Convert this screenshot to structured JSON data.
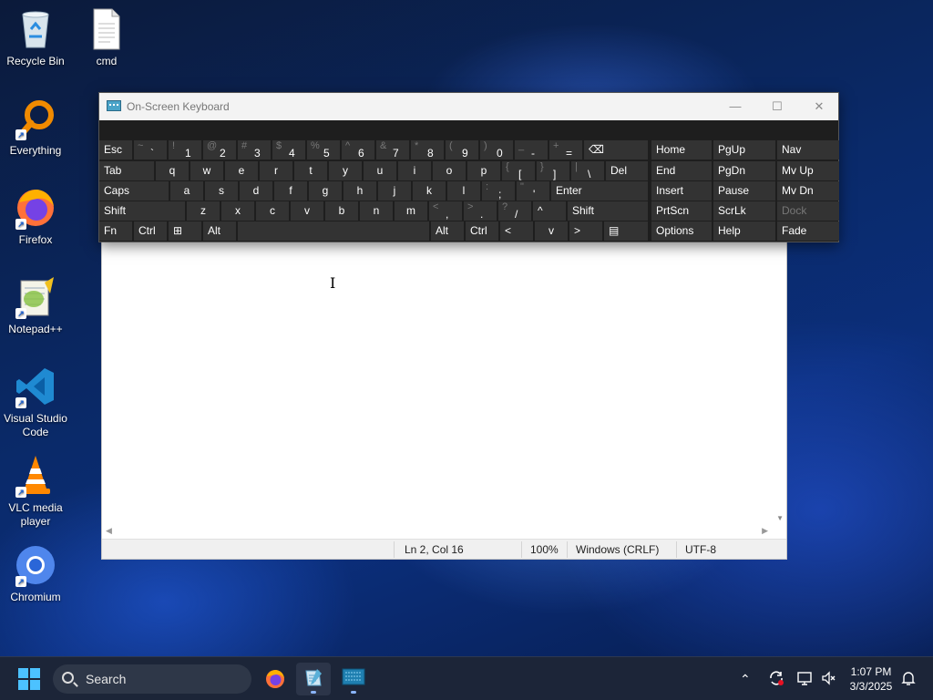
{
  "desktop": {
    "icons": [
      {
        "label": "Recycle Bin",
        "icon": "recycle-bin-icon"
      },
      {
        "label": "cmd",
        "icon": "file-icon"
      },
      {
        "label": "Everything",
        "icon": "everything-search-icon"
      },
      {
        "label": "Firefox",
        "icon": "firefox-icon"
      },
      {
        "label": "Notepad++",
        "icon": "notepad-plus-plus-icon"
      },
      {
        "label": "Visual Studio Code",
        "icon": "vscode-icon"
      },
      {
        "label": "VLC media player",
        "icon": "vlc-icon"
      },
      {
        "label": "Chromium",
        "icon": "chromium-icon"
      }
    ]
  },
  "osk": {
    "title": "On-Screen Keyboard",
    "row1": [
      {
        "label": "Esc"
      },
      {
        "shift": "~",
        "main": "`"
      },
      {
        "shift": "!",
        "main": "1"
      },
      {
        "shift": "@",
        "main": "2"
      },
      {
        "shift": "#",
        "main": "3"
      },
      {
        "shift": "$",
        "main": "4"
      },
      {
        "shift": "%",
        "main": "5"
      },
      {
        "shift": "^",
        "main": "6"
      },
      {
        "shift": "&",
        "main": "7"
      },
      {
        "shift": "*",
        "main": "8"
      },
      {
        "shift": "(",
        "main": "9"
      },
      {
        "shift": ")",
        "main": "0"
      },
      {
        "shift": "_",
        "main": "-"
      },
      {
        "shift": "+",
        "main": "="
      },
      {
        "label": "⌫"
      }
    ],
    "row2": [
      {
        "label": "Tab"
      },
      {
        "label": "q"
      },
      {
        "label": "w"
      },
      {
        "label": "e"
      },
      {
        "label": "r"
      },
      {
        "label": "t"
      },
      {
        "label": "y"
      },
      {
        "label": "u"
      },
      {
        "label": "i"
      },
      {
        "label": "o"
      },
      {
        "label": "p"
      },
      {
        "shift": "{",
        "main": "["
      },
      {
        "shift": "}",
        "main": "]"
      },
      {
        "shift": "|",
        "main": "\\"
      },
      {
        "label": "Del"
      }
    ],
    "row3": [
      {
        "label": "Caps"
      },
      {
        "label": "a"
      },
      {
        "label": "s"
      },
      {
        "label": "d"
      },
      {
        "label": "f"
      },
      {
        "label": "g"
      },
      {
        "label": "h"
      },
      {
        "label": "j"
      },
      {
        "label": "k"
      },
      {
        "label": "l"
      },
      {
        "shift": ":",
        "main": ";"
      },
      {
        "shift": "\"",
        "main": "'"
      },
      {
        "label": "Enter"
      }
    ],
    "row4": [
      {
        "label": "Shift"
      },
      {
        "label": "z"
      },
      {
        "label": "x"
      },
      {
        "label": "c"
      },
      {
        "label": "v"
      },
      {
        "label": "b"
      },
      {
        "label": "n"
      },
      {
        "label": "m"
      },
      {
        "shift": "<",
        "main": ","
      },
      {
        "shift": ">",
        "main": "."
      },
      {
        "shift": "?",
        "main": "/"
      },
      {
        "label": "^"
      },
      {
        "label": "Shift"
      }
    ],
    "row5": [
      {
        "label": "Fn"
      },
      {
        "label": "Ctrl"
      },
      {
        "label": "⊞"
      },
      {
        "label": "Alt"
      },
      {
        "label": ""
      },
      {
        "label": "Alt"
      },
      {
        "label": "Ctrl"
      },
      {
        "label": "<"
      },
      {
        "label": "v"
      },
      {
        "label": ">"
      },
      {
        "label": "▤"
      }
    ],
    "nav": [
      [
        "Home",
        "PgUp",
        "Nav"
      ],
      [
        "End",
        "PgDn",
        "Mv Up"
      ],
      [
        "Insert",
        "Pause",
        "Mv Dn"
      ],
      [
        "PrtScn",
        "ScrLk",
        "Dock"
      ],
      [
        "Options",
        "Help",
        "Fade"
      ]
    ]
  },
  "notepad": {
    "status": {
      "position": "Ln 2, Col 16",
      "zoom": "100%",
      "line_ending": "Windows (CRLF)",
      "encoding": "UTF-8"
    }
  },
  "taskbar": {
    "search_label": "Search",
    "clock_time": "1:07 PM",
    "clock_date": "3/3/2025"
  }
}
